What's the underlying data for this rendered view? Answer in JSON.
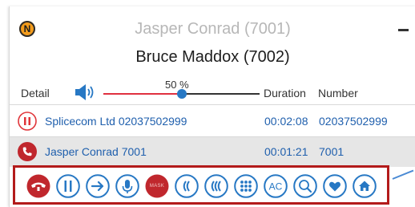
{
  "header": {
    "secondary_caller": "Jasper Conrad (7001)",
    "primary_caller": "Bruce Maddox (7002)",
    "logo_letter": "N",
    "logo_color": "#f39c1c"
  },
  "columns": {
    "detail": "Detail",
    "duration": "Duration",
    "number": "Number"
  },
  "volume": {
    "label": "50 %",
    "level": 0.5
  },
  "calls": [
    {
      "name": "Splicecom Ltd 02037502999",
      "duration": "00:02:08",
      "number": "02037502999",
      "state": "on-hold",
      "icon": "pause-icon"
    },
    {
      "name": "Jasper Conrad 7001",
      "duration": "00:01:21",
      "number": "7001",
      "state": "active",
      "icon": "phone-icon"
    }
  ],
  "toolbar": {
    "mask_label": "MASK",
    "dtmf_label": "AC",
    "buttons": [
      "hangup-icon",
      "hold-icon",
      "transfer-icon",
      "mute-icon",
      "mask-icon",
      "conference-icon",
      "multi-conference-icon",
      "keypad-icon",
      "ac-icon",
      "search-icon",
      "favourite-icon",
      "home-icon"
    ]
  },
  "colors": {
    "accent_blue": "#2778c4",
    "hangup_red": "#c0272d",
    "highlight_border": "#b31b1b",
    "link_blue": "#1f5fad"
  }
}
